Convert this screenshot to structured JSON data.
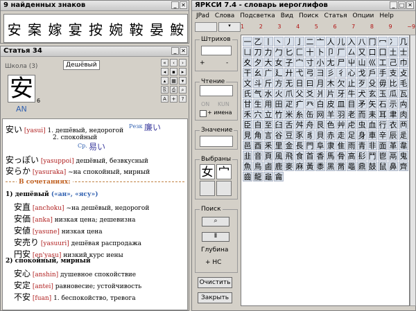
{
  "found": {
    "title": "9 найденных знаков",
    "kanji": [
      "安",
      "案",
      "嫁",
      "宴",
      "按",
      "婉",
      "鞍",
      "晏",
      "鮟"
    ]
  },
  "article": {
    "title": "Статья 34",
    "school_label": "Школа (3)",
    "meaning_tag": "Дешёвый",
    "kanji": "安",
    "stroke_num": "6",
    "on_reading": "AN",
    "entries": [
      {
        "word": "安い",
        "reading": "[yasui]",
        "meaning": "1. дешёвый, недорогой"
      },
      {
        "word": "",
        "reading": "",
        "meaning": "2. спокойный"
      },
      {
        "word": "安っぽい",
        "reading": "[yasuppoi]",
        "meaning": "дешёвый, безвкусный"
      },
      {
        "word": "安らか",
        "reading": "[yasuraka]",
        "meaning": "~на  спокойный, мирный"
      }
    ],
    "antonym_label": "Резк",
    "antonym": "廉い",
    "synonym_label": "Ср.",
    "synonym": "易い",
    "section": "В сочетаниях:",
    "group1": "1) дешёвый",
    "group1_readings": "(«ан», «ясу»)",
    "group2": "2) спокойный, мирный",
    "compounds1": [
      {
        "word": "安直",
        "reading": "[anchoku]",
        "meaning": "~на  дешёвый, недорогой"
      },
      {
        "word": "安価",
        "reading": "[anka]",
        "meaning": "низкая цена;  дешевизна"
      },
      {
        "word": "安値",
        "reading": "[yasune]",
        "meaning": "низкая цена"
      },
      {
        "word": "安売り",
        "reading": "[yasuuri]",
        "meaning": "дешёвая распродажа"
      },
      {
        "word": "円安",
        "reading": "[en'yasu]",
        "meaning": "низкий курс иены"
      }
    ],
    "compounds2": [
      {
        "word": "安心",
        "reading": "[anshin]",
        "meaning": "душевное спокойствие"
      },
      {
        "word": "安定",
        "reading": "[antei]",
        "meaning": "равновесие;  устойчивость"
      },
      {
        "word": "不安",
        "reading": "[fuan]",
        "meaning": "1. беспокойство, тревога"
      }
    ]
  },
  "main": {
    "title": "ЯРКСИ 7.4  -  словарь иероглифов",
    "menu": [
      "JPad",
      "Слова",
      "Подсветка",
      "Вид",
      "Поиск",
      "Статья",
      "Опции",
      "Help"
    ],
    "col_numbers": [
      "1",
      "2",
      "3",
      "4",
      "5",
      "6",
      "7",
      "8",
      "9",
      "~9"
    ],
    "strokes_label": "Штрихов",
    "plus": "+",
    "minus": "-",
    "reading_label": "Чтение",
    "on_label": "ON",
    "kun_label": "KUN",
    "names_label": "+ имена",
    "meaning_label": "Значение",
    "selected_label": "Выбраны",
    "selected": [
      "女",
      "宀"
    ],
    "search_label": "Поиск",
    "depth_label": "Глубина",
    "ns_label": "+ НС",
    "clear_btn": "Очистить",
    "close_btn": "Закрыть",
    "grid_kanji": "一乙丨丶丿亅二亠人儿入八冂冖冫几凵刀力勹匕匚十卜卩厂厶又口囗土士夊夕大女子宀寸小尢尸屮山巛工己巾干幺广廴廾弋弓彐彡彳心戈戶手支攴文斗斤方无日曰月木欠止歹殳毋比毛氏气水火爪父爻爿片牙牛犬玄玉瓜瓦甘生用田疋疒癶白皮皿目矛矢石示禸禾穴立竹米糸缶网羊羽老而耒耳聿肉臣自至臼舌舛舟艮色艸虍虫血行衣襾見角言谷豆豕豸貝赤走足身車辛辰辵邑酉釆里金長門阜隶隹雨青非面革韋韭音頁風飛食首香馬骨高髟鬥鬯鬲鬼魚鳥鹵鹿麥麻黃黍黑黹黽鼎鼓鼠鼻齊齒龍龜龠"
  },
  "icons": [
    "close-icon",
    "minimize-icon",
    "maximize-icon",
    "arrow-icon",
    "search-icon"
  ]
}
